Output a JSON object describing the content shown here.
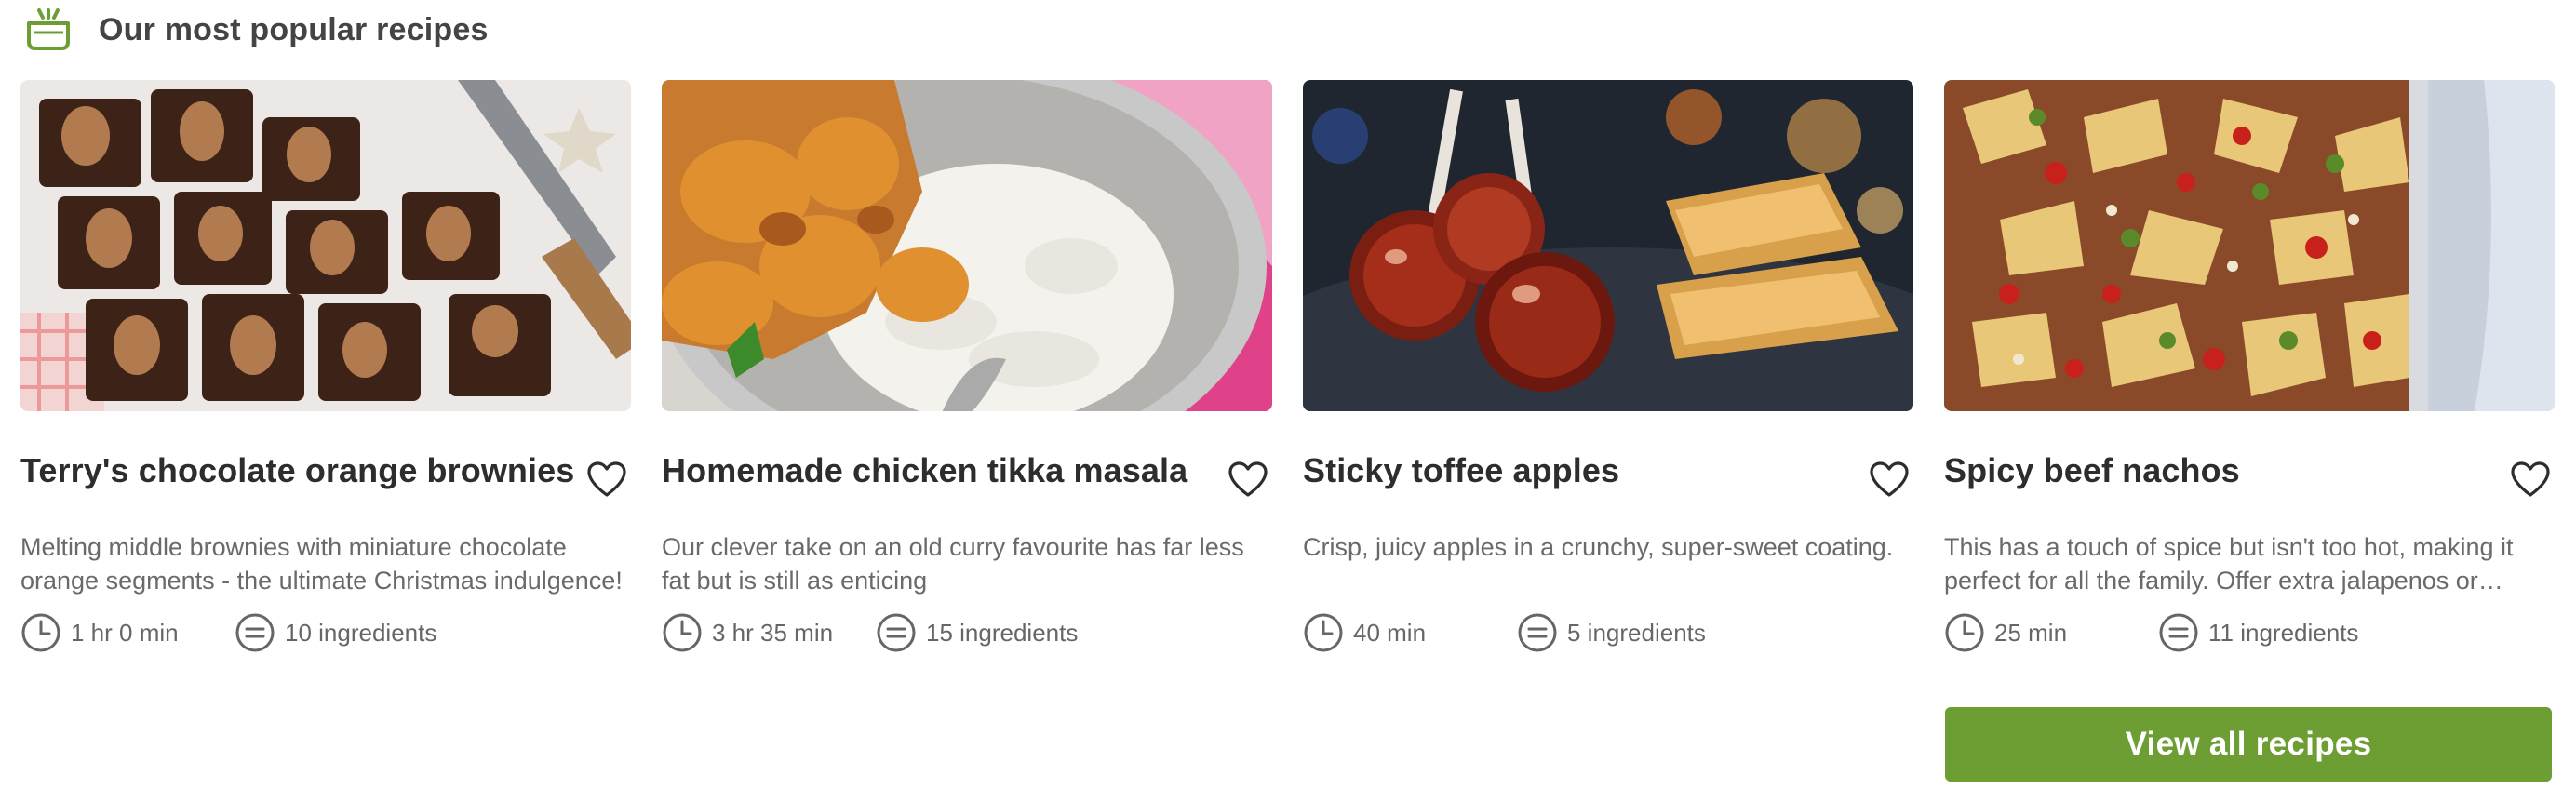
{
  "header": {
    "title": "Our most popular recipes",
    "icon": "cooking-pot-icon",
    "accent_color": "#6d9e33"
  },
  "recipes": [
    {
      "title": "Terry's chocolate orange brownies",
      "description": "Melting middle brownies with miniature chocolate orange segments - the ultimate Christmas indulgence!",
      "time": "1 hr 0 min",
      "ingredients": "10 ingredients",
      "image": "brownies-photo"
    },
    {
      "title": "Homemade chicken tikka masala",
      "description": "Our clever take on an old curry favourite has far less fat but is still as enticing",
      "time": "3 hr 35 min",
      "ingredients": "15 ingredients",
      "image": "tikka-masala-photo"
    },
    {
      "title": "Sticky toffee apples",
      "description": "Crisp, juicy apples in a crunchy, super-sweet coating.",
      "time": "40 min",
      "ingredients": "5 ingredients",
      "image": "toffee-apples-photo"
    },
    {
      "title": "Spicy beef nachos",
      "description": "This has a touch of spice but isn't too hot, making it perfect for all the family. Offer extra jalapenos or…",
      "time": "25 min",
      "ingredients": "11 ingredients",
      "image": "beef-nachos-photo"
    }
  ],
  "view_all_label": "View all recipes",
  "icons": {
    "save": "heart-icon",
    "time": "clock-icon",
    "ingredients": "list-icon"
  }
}
